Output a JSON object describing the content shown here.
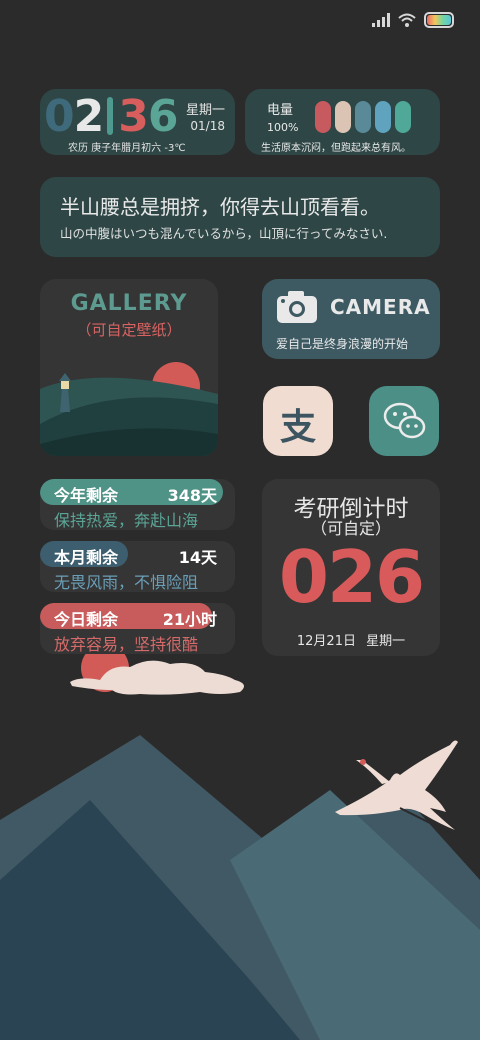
{
  "status_bar": {
    "icons": [
      "signal-icon",
      "wifi-icon",
      "battery-icon"
    ]
  },
  "clock": {
    "hour_1": "0",
    "hour_2": "2",
    "separator": "",
    "minute_1": "3",
    "minute_2": "6",
    "weekday": "星期一",
    "date": "01/18",
    "lunar_weather": "农历  庚子年腊月初六  -3℃"
  },
  "battery": {
    "label": "电量",
    "percent": "100%",
    "subtitle": "生活原本沉闷，但跑起来总有风。",
    "pill_colors": [
      "#c65a5e",
      "#dbc4b4",
      "#5a8a98",
      "#5fa3be",
      "#4fa898"
    ]
  },
  "quote": {
    "line_cn": "半山腰总是拥挤，你得去山顶看看。",
    "line_jp": "山の中腹はいつも混んでいるから，山頂に行ってみなさい."
  },
  "gallery": {
    "title": "GALLERY",
    "subtitle": "（可自定壁纸）"
  },
  "camera": {
    "title": "CAMERA",
    "subtitle": "爱自己是终身浪漫的开始"
  },
  "apps": [
    {
      "name": "alipay",
      "icon": "alipay-icon",
      "glyph": "支",
      "bg": "#f1dcd2",
      "fg": "#3d5560"
    },
    {
      "name": "wechat",
      "icon": "wechat-icon",
      "bg": "#4c8f87"
    }
  ],
  "countdowns": [
    {
      "label": "今年剩余",
      "value": "348天",
      "motto": "保持热爱，奔赴山海",
      "color": "#4f9286",
      "motto_color": "#5aa596",
      "fill": 0.95
    },
    {
      "label": "本月剩余",
      "value": "14天",
      "motto": "无畏风雨，不惧险阻",
      "color": "#3d5e6e",
      "motto_color": "#6a9fb8",
      "fill": 0.45
    },
    {
      "label": "今日剩余",
      "value": "21小时",
      "motto": "放弃容易，坚持很酷",
      "color": "#c85b5b",
      "motto_color": "#d56a6a",
      "fill": 0.88
    }
  ],
  "exam": {
    "title": "考研倒计时",
    "subtitle": "（可自定）",
    "days": "026",
    "date": "12月21日 星期一"
  }
}
